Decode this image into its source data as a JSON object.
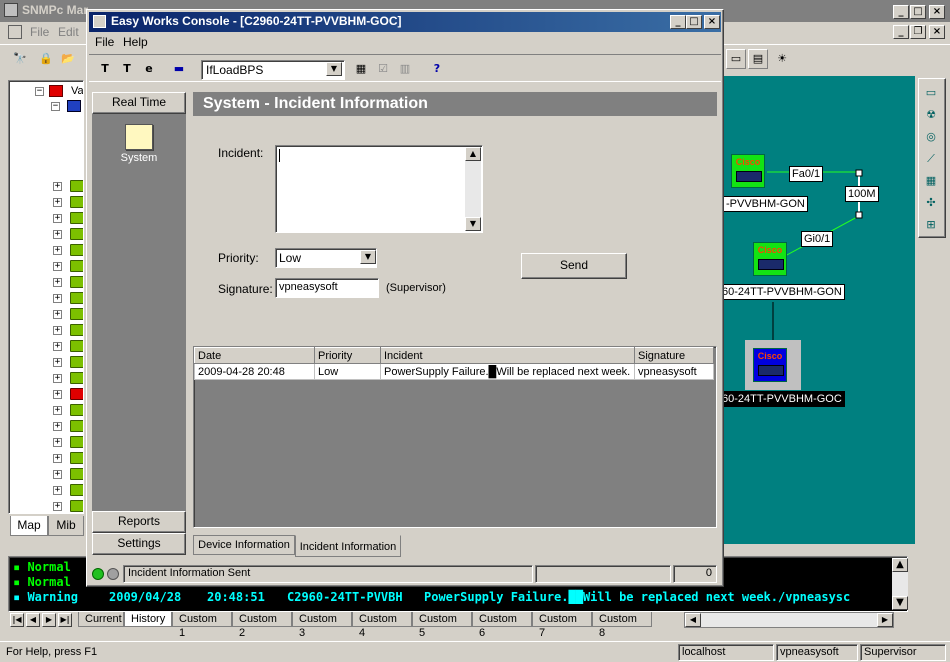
{
  "main_window": {
    "title": "SNMPc Mar",
    "menu": [
      "File",
      "Edit"
    ],
    "tree_root_label": "Va",
    "left_tabs": [
      "Map",
      "Mib"
    ],
    "map_labels": {
      "port_top": "Fa0/1",
      "link_speed": "100M",
      "port_bottom": "Gi0/1",
      "node1": "-PVVBHM-GON",
      "node2": "60-24TT-PVVBHM-GON",
      "node3": "60-24TT-PVVBHM-GOC"
    },
    "node_badge": "Cisco"
  },
  "event_log": {
    "rows": [
      {
        "status": "Normal"
      },
      {
        "status": "Normal"
      },
      {
        "status": "Warning",
        "date": "2009/04/28",
        "time": "20:48:51",
        "device": "C2960-24TT-PVVBH",
        "message": "PowerSupply Failure.██Will be replaced next week./vpneasysc"
      }
    ],
    "tabs": [
      "Current",
      "History",
      "Custom 1",
      "Custom 2",
      "Custom 3",
      "Custom 4",
      "Custom 5",
      "Custom 6",
      "Custom 7",
      "Custom 8"
    ],
    "active_tab": "History"
  },
  "status_bar": {
    "help": "For Help, press F1",
    "host": "localhost",
    "user": "vpneasysoft",
    "role": "Supervisor"
  },
  "console": {
    "title": "Easy Works Console - [C2960-24TT-PVVBHM-GOC]",
    "menu": [
      "File",
      "Help"
    ],
    "toolbar_select": "IfLoadBPS",
    "side": {
      "top_button": "Real Time",
      "item_label": "System",
      "reports": "Reports",
      "settings": "Settings"
    },
    "panel_title": "System - Incident Information",
    "form": {
      "incident_label": "Incident:",
      "incident_value": "",
      "priority_label": "Priority:",
      "priority_value": "Low",
      "signature_label": "Signature:",
      "signature_value": "vpneasysoft",
      "signature_role": "(Supervisor)",
      "send_button": "Send"
    },
    "table": {
      "columns": [
        "Date",
        "Priority",
        "Incident",
        "Signature"
      ],
      "rows": [
        [
          "2009-04-28  20:48",
          "Low",
          "PowerSupply Failure.█Will be replaced next week.",
          "vpneasysoft"
        ]
      ]
    },
    "tabs": [
      "Device Information",
      "Incident Information"
    ],
    "active_tab": "Incident Information",
    "status_text": "Incident Information Sent",
    "status_count": "0"
  },
  "colors": {
    "map_bg": "#008080",
    "node_green": "#13e313",
    "log_bg": "#000000",
    "log_normal": "#00ff00",
    "log_warning": "#00ffff",
    "titlebar": "#0a246a"
  }
}
